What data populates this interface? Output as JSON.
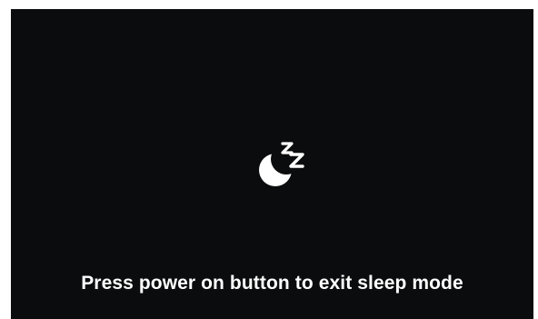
{
  "sleep_screen": {
    "icon": "moon-zzz-icon",
    "message": "Press power on button to exit sleep mode"
  },
  "colors": {
    "background": "#0b0c0d",
    "text": "#ffffff",
    "icon": "#ffffff"
  }
}
